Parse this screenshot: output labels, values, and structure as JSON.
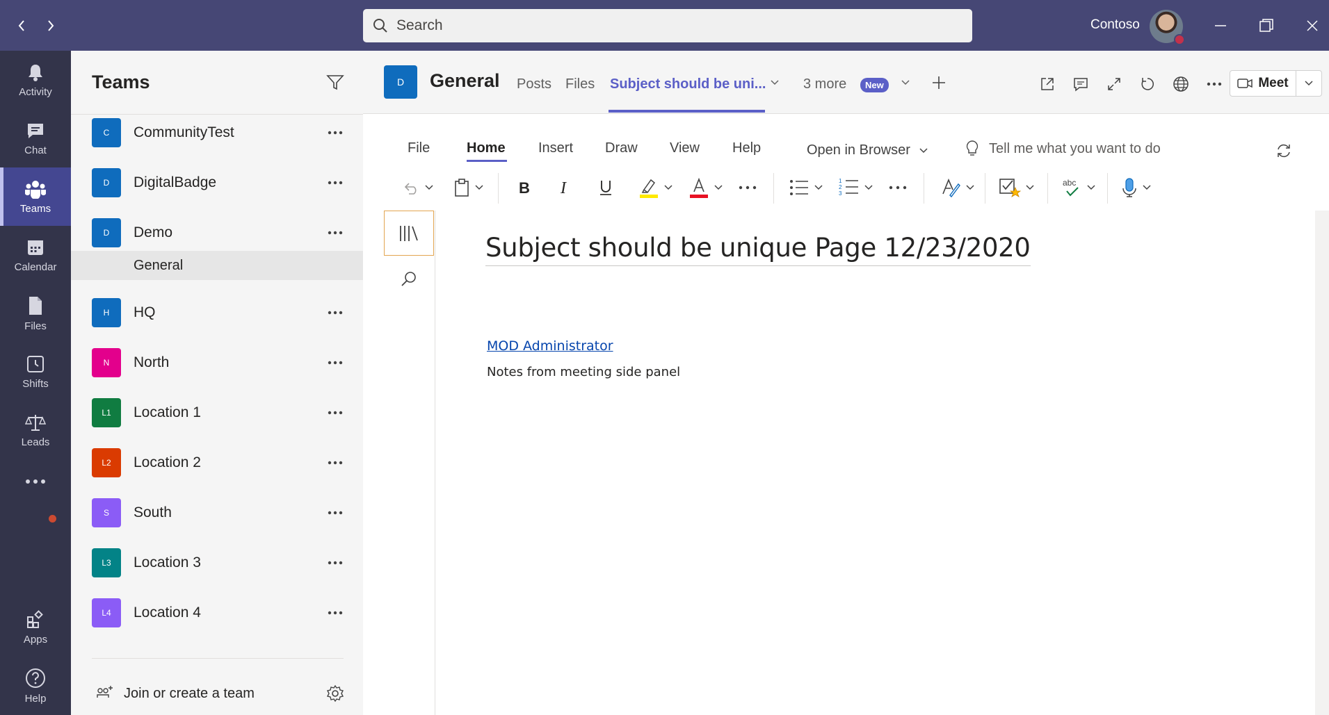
{
  "titlebar": {
    "search_placeholder": "Search",
    "tenant": "Contoso"
  },
  "rail": {
    "items": [
      {
        "label": "Activity",
        "icon": "bell-icon"
      },
      {
        "label": "Chat",
        "icon": "chat-icon"
      },
      {
        "label": "Teams",
        "icon": "teams-icon"
      },
      {
        "label": "Calendar",
        "icon": "calendar-icon"
      },
      {
        "label": "Files",
        "icon": "file-icon"
      },
      {
        "label": "Shifts",
        "icon": "clock-icon"
      },
      {
        "label": "Leads",
        "icon": "scales-icon"
      },
      {
        "label": "Apps",
        "icon": "apps-icon"
      },
      {
        "label": "Help",
        "icon": "help-icon"
      }
    ],
    "active": "Teams"
  },
  "panel": {
    "title": "Teams",
    "teams": [
      {
        "initial": "C",
        "name": "CommunityTest",
        "color": "#0f6cbd"
      },
      {
        "initial": "D",
        "name": "DigitalBadge",
        "color": "#0f6cbd"
      },
      {
        "initial": "D",
        "name": "Demo",
        "color": "#0f6cbd"
      },
      {
        "initial": "H",
        "name": "HQ",
        "color": "#0f6cbd"
      },
      {
        "initial": "N",
        "name": "North",
        "color": "#e3008c"
      },
      {
        "initial": "L1",
        "name": "Location 1",
        "color": "#107c41"
      },
      {
        "initial": "L2",
        "name": "Location 2",
        "color": "#da3b01"
      },
      {
        "initial": "S",
        "name": "South",
        "color": "#8b5cf6"
      },
      {
        "initial": "L3",
        "name": "Location 3",
        "color": "#038387"
      },
      {
        "initial": "L4",
        "name": "Location 4",
        "color": "#8b5cf6"
      }
    ],
    "selected_channel": "General",
    "join_label": "Join or create a team"
  },
  "channel": {
    "badge": "D",
    "title": "General",
    "tabs": [
      "Posts",
      "Files",
      "Subject should be uni..."
    ],
    "more_label": "3 more",
    "new_badge": "New",
    "meet_label": "Meet"
  },
  "ribbon": {
    "tabs": [
      "File",
      "Home",
      "Insert",
      "Draw",
      "View",
      "Help"
    ],
    "active_tab": "Home",
    "open_in_browser": "Open in Browser",
    "tell_me": "Tell me what you want to do",
    "highlight_color": "#ffe900",
    "font_color": "#e81123"
  },
  "note": {
    "page_title": "Subject should be unique Page 12/23/2020",
    "link": "MOD Administrator",
    "body": "Notes from meeting side panel"
  }
}
